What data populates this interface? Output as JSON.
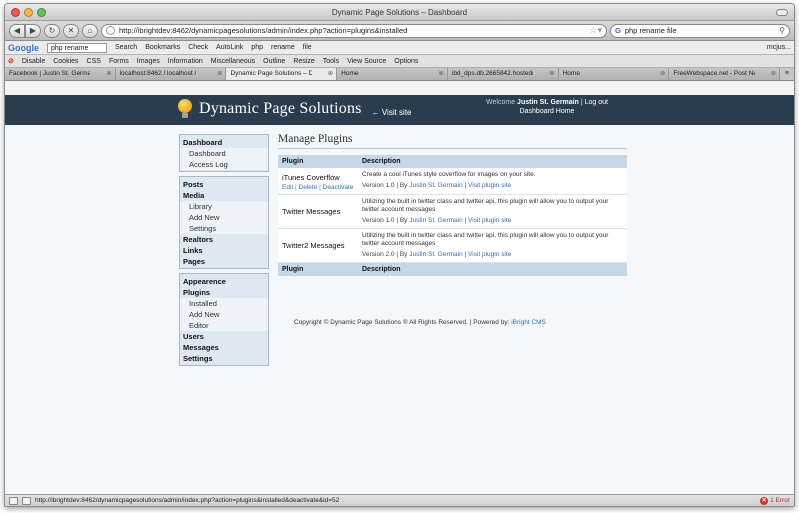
{
  "window": {
    "title": "Dynamic Page Solutions – Dashboard"
  },
  "navbar": {
    "url": "http://ibrightdev:8462/dynamicpagesolutions/admin/index.php?action=plugins&installed",
    "search_query": "php rename file",
    "search_engine": "G"
  },
  "google_toolbar": {
    "logo": "Google",
    "query": "php rename",
    "items": [
      "Search",
      "Bookmarks",
      "Check",
      "AutoLink",
      "php",
      "rename",
      "file"
    ],
    "right": "mcjus..."
  },
  "webdev_toolbar": {
    "items": [
      "Disable",
      "Cookies",
      "CSS",
      "Forms",
      "Images",
      "Information",
      "Miscellaneous",
      "Outline",
      "Resize",
      "Tools",
      "View Source",
      "Options"
    ]
  },
  "tabs": [
    {
      "label": "Facebook | Justin St. Germain"
    },
    {
      "label": "localhost:8462 / localhost /"
    },
    {
      "label": "Dynamic Page Solutions – Da..."
    },
    {
      "label": "Home"
    },
    {
      "label": "ibd_dps.db.2665842.hostedr"
    },
    {
      "label": "Home"
    },
    {
      "label": "FreeWebspace.net - Post Ne..."
    }
  ],
  "site": {
    "logo_text": "Dynamic Page Solutions",
    "visit_site": "← Visit site",
    "welcome_prefix": "Welcome",
    "user_name": "Justin St. Germain",
    "separator": "|",
    "logout": "Log out",
    "dashboard_home": "Dashboard Home"
  },
  "sidebar": {
    "group1": {
      "heading": "Dashboard",
      "subs": [
        "Dashboard",
        "Access Log"
      ]
    },
    "group2": {
      "posts": "Posts",
      "media": "Media",
      "media_subs": [
        "Library",
        "Add New",
        "Settings"
      ],
      "realtors": "Realtors",
      "links": "Links",
      "pages": "Pages"
    },
    "group3": {
      "appearance": "Appearence",
      "plugins": "Plugins",
      "plugins_subs": [
        "Installed",
        "Add New",
        "Editor"
      ],
      "users": "Users",
      "messages": "Messages",
      "settings": "Settings"
    }
  },
  "main": {
    "title": "Manage Plugins",
    "col_plugin": "Plugin",
    "col_description": "Description",
    "actions": {
      "edit": "Edit",
      "delete": "Delete",
      "deactivate": "Deactivate",
      "sep": "|"
    },
    "plugins": [
      {
        "name": "iTunes Coverflow",
        "description": "Create a cool iTunes style coverflow for images on your site.",
        "version": "Version 1.0",
        "by": "By",
        "author": "Justin St. Germain",
        "visit": "Visit plugin site"
      },
      {
        "name": "Twitter Messages",
        "description": "Utilizing the built in twitter class and twitter api, this plugin will allow you to output your twitter account messages",
        "version": "Version 1.0",
        "by": "By",
        "author": "Justin St. Germain",
        "visit": "Visit plugin site"
      },
      {
        "name": "Twitter2 Messages",
        "description": "Utilizing the built in twitter class and twitter api, this plugin will allow you to output your twitter account messages",
        "version": "Version 2.0",
        "by": "By",
        "author": "Justin St. Germain",
        "visit": "Visit plugin site"
      }
    ]
  },
  "footer": {
    "copyright": "Copyright © Dynamic Page Solutions ® All Rights Reserved. | Powered by:",
    "powered": "iBright CMS"
  },
  "statusbar": {
    "url": "http://ibrightdev:8462/dynamicpagesolutions/admin/index.php?action=plugins&installed&deactivate&id=52",
    "errors": "1 Error"
  },
  "colors": {
    "header_bg": "#2a3d4f",
    "table_header": "#c5d8e8",
    "link": "#3a6ea5",
    "sidebar_bg": "#dde8f2"
  }
}
